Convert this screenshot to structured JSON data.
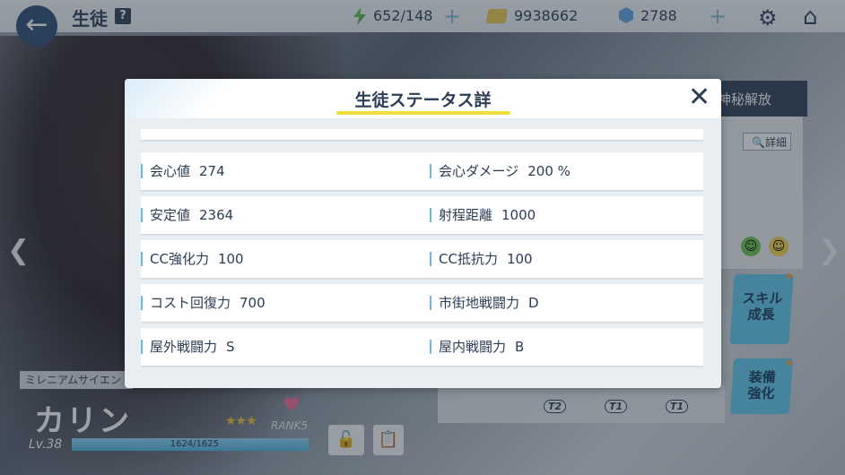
{
  "topbar": {
    "title": "生徒",
    "help": "?",
    "ap": "652/148",
    "credits": "9938662",
    "gems": "2788"
  },
  "side": {
    "mystic_unlock": "神秘解放",
    "detail": "詳細",
    "skill_button": [
      "スキル",
      "成長"
    ],
    "equip_button": [
      "装備",
      "強化"
    ],
    "tiers": [
      "T2",
      "T1",
      "T1"
    ]
  },
  "character": {
    "club": "ミレニアムサイエン",
    "name": "カリン",
    "stars": "★★★",
    "rank": "RANK5",
    "level": "Lv.38",
    "exp": "1624/1625",
    "exp_fraction": 0.999
  },
  "modal": {
    "title": "生徒ステータス詳",
    "close": "✕",
    "rows": [
      [
        {
          "label": "会心値",
          "value": "274"
        },
        {
          "label": "会心ダメージ",
          "value": "200 %"
        }
      ],
      [
        {
          "label": "安定値",
          "value": "2364"
        },
        {
          "label": "射程距離",
          "value": "1000"
        }
      ],
      [
        {
          "label": "CC強化力",
          "value": "100"
        },
        {
          "label": "CC抵抗力",
          "value": "100"
        }
      ],
      [
        {
          "label": "コスト回復力",
          "value": "700"
        },
        {
          "label": "市街地戦闘力",
          "value": "D"
        }
      ],
      [
        {
          "label": "屋外戦闘力",
          "value": "S"
        },
        {
          "label": "屋内戦闘力",
          "value": "B"
        }
      ]
    ]
  },
  "colors": {
    "accent": "#2b3e55",
    "highlight": "#f0df3a",
    "bar": "#6ab8e6"
  }
}
